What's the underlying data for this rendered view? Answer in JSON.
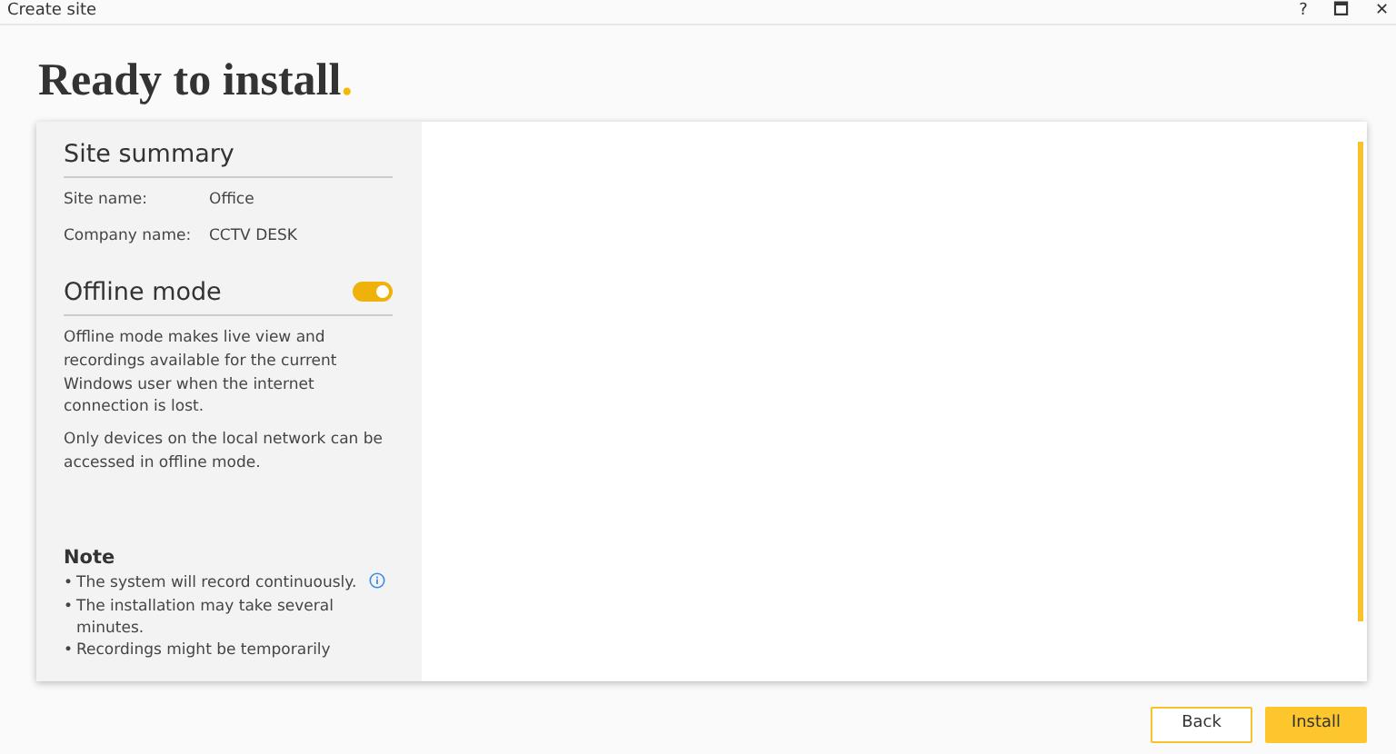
{
  "window": {
    "title": "Create site",
    "controls": [
      "?",
      "🗖",
      "✕"
    ]
  },
  "heading": {
    "text": "Ready to install",
    "mark": "."
  },
  "summary": {
    "title": "Site summary",
    "fields": [
      {
        "label": "Site name:",
        "value": "Office"
      },
      {
        "label": "Company name:",
        "value": "CCTV DESK"
      }
    ]
  },
  "offline": {
    "title": "Offline mode",
    "on": true,
    "paragraphs": [
      "Offline mode makes live view and recordings available for the current Windows user when the internet connection is lost.",
      "Only devices on the local network can be accessed in offline mode."
    ]
  },
  "note": {
    "title": "Note",
    "bullet": "•",
    "items": [
      {
        "text": "The system will record continuously.",
        "info": true
      },
      {
        "text": "The installation may take several minutes.",
        "info": false
      },
      {
        "text": "Recordings might be temporarily",
        "info": false
      }
    ]
  },
  "buttons": [
    {
      "label": "Back",
      "kind": "secondary"
    },
    {
      "label": "Install",
      "kind": "primary"
    }
  ]
}
